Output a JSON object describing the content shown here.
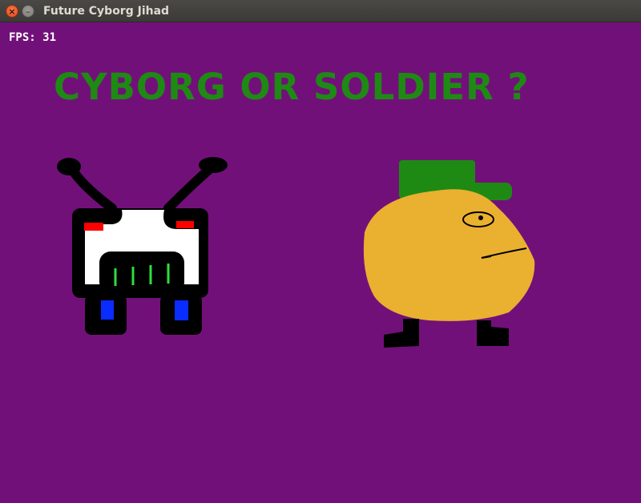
{
  "window": {
    "title": "Future Cyborg Jihad",
    "close_glyph": "×",
    "minimize_glyph": "–"
  },
  "hud": {
    "fps_label": "FPS:",
    "fps_value": "31"
  },
  "game": {
    "question": "CYBORG OR SOLDIER ?",
    "background_color": "#72107a",
    "question_color": "#1e8a14",
    "choices": [
      "cyborg",
      "soldier"
    ]
  }
}
